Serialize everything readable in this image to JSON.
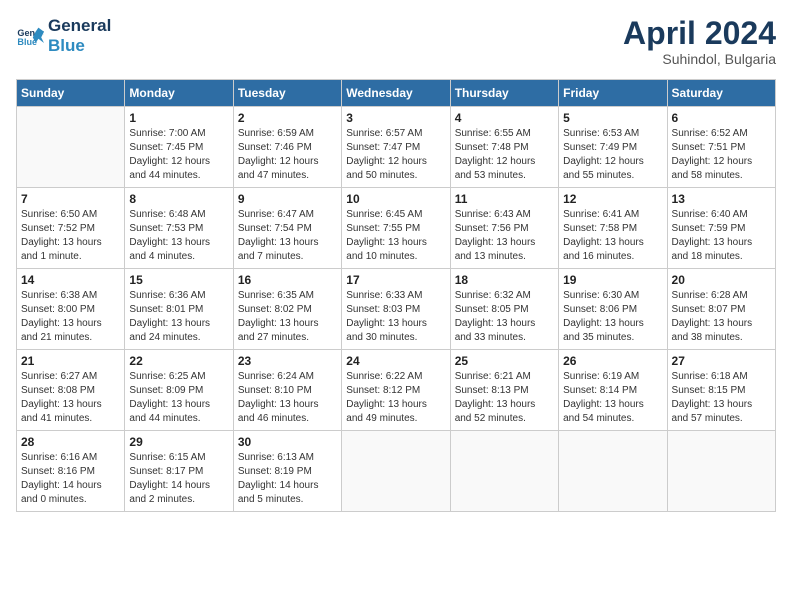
{
  "header": {
    "logo_general": "General",
    "logo_blue": "Blue",
    "month_title": "April 2024",
    "subtitle": "Suhindol, Bulgaria"
  },
  "days_of_week": [
    "Sunday",
    "Monday",
    "Tuesday",
    "Wednesday",
    "Thursday",
    "Friday",
    "Saturday"
  ],
  "weeks": [
    [
      {
        "day": "",
        "info": ""
      },
      {
        "day": "1",
        "info": "Sunrise: 7:00 AM\nSunset: 7:45 PM\nDaylight: 12 hours\nand 44 minutes."
      },
      {
        "day": "2",
        "info": "Sunrise: 6:59 AM\nSunset: 7:46 PM\nDaylight: 12 hours\nand 47 minutes."
      },
      {
        "day": "3",
        "info": "Sunrise: 6:57 AM\nSunset: 7:47 PM\nDaylight: 12 hours\nand 50 minutes."
      },
      {
        "day": "4",
        "info": "Sunrise: 6:55 AM\nSunset: 7:48 PM\nDaylight: 12 hours\nand 53 minutes."
      },
      {
        "day": "5",
        "info": "Sunrise: 6:53 AM\nSunset: 7:49 PM\nDaylight: 12 hours\nand 55 minutes."
      },
      {
        "day": "6",
        "info": "Sunrise: 6:52 AM\nSunset: 7:51 PM\nDaylight: 12 hours\nand 58 minutes."
      }
    ],
    [
      {
        "day": "7",
        "info": "Sunrise: 6:50 AM\nSunset: 7:52 PM\nDaylight: 13 hours\nand 1 minute."
      },
      {
        "day": "8",
        "info": "Sunrise: 6:48 AM\nSunset: 7:53 PM\nDaylight: 13 hours\nand 4 minutes."
      },
      {
        "day": "9",
        "info": "Sunrise: 6:47 AM\nSunset: 7:54 PM\nDaylight: 13 hours\nand 7 minutes."
      },
      {
        "day": "10",
        "info": "Sunrise: 6:45 AM\nSunset: 7:55 PM\nDaylight: 13 hours\nand 10 minutes."
      },
      {
        "day": "11",
        "info": "Sunrise: 6:43 AM\nSunset: 7:56 PM\nDaylight: 13 hours\nand 13 minutes."
      },
      {
        "day": "12",
        "info": "Sunrise: 6:41 AM\nSunset: 7:58 PM\nDaylight: 13 hours\nand 16 minutes."
      },
      {
        "day": "13",
        "info": "Sunrise: 6:40 AM\nSunset: 7:59 PM\nDaylight: 13 hours\nand 18 minutes."
      }
    ],
    [
      {
        "day": "14",
        "info": "Sunrise: 6:38 AM\nSunset: 8:00 PM\nDaylight: 13 hours\nand 21 minutes."
      },
      {
        "day": "15",
        "info": "Sunrise: 6:36 AM\nSunset: 8:01 PM\nDaylight: 13 hours\nand 24 minutes."
      },
      {
        "day": "16",
        "info": "Sunrise: 6:35 AM\nSunset: 8:02 PM\nDaylight: 13 hours\nand 27 minutes."
      },
      {
        "day": "17",
        "info": "Sunrise: 6:33 AM\nSunset: 8:03 PM\nDaylight: 13 hours\nand 30 minutes."
      },
      {
        "day": "18",
        "info": "Sunrise: 6:32 AM\nSunset: 8:05 PM\nDaylight: 13 hours\nand 33 minutes."
      },
      {
        "day": "19",
        "info": "Sunrise: 6:30 AM\nSunset: 8:06 PM\nDaylight: 13 hours\nand 35 minutes."
      },
      {
        "day": "20",
        "info": "Sunrise: 6:28 AM\nSunset: 8:07 PM\nDaylight: 13 hours\nand 38 minutes."
      }
    ],
    [
      {
        "day": "21",
        "info": "Sunrise: 6:27 AM\nSunset: 8:08 PM\nDaylight: 13 hours\nand 41 minutes."
      },
      {
        "day": "22",
        "info": "Sunrise: 6:25 AM\nSunset: 8:09 PM\nDaylight: 13 hours\nand 44 minutes."
      },
      {
        "day": "23",
        "info": "Sunrise: 6:24 AM\nSunset: 8:10 PM\nDaylight: 13 hours\nand 46 minutes."
      },
      {
        "day": "24",
        "info": "Sunrise: 6:22 AM\nSunset: 8:12 PM\nDaylight: 13 hours\nand 49 minutes."
      },
      {
        "day": "25",
        "info": "Sunrise: 6:21 AM\nSunset: 8:13 PM\nDaylight: 13 hours\nand 52 minutes."
      },
      {
        "day": "26",
        "info": "Sunrise: 6:19 AM\nSunset: 8:14 PM\nDaylight: 13 hours\nand 54 minutes."
      },
      {
        "day": "27",
        "info": "Sunrise: 6:18 AM\nSunset: 8:15 PM\nDaylight: 13 hours\nand 57 minutes."
      }
    ],
    [
      {
        "day": "28",
        "info": "Sunrise: 6:16 AM\nSunset: 8:16 PM\nDaylight: 14 hours\nand 0 minutes."
      },
      {
        "day": "29",
        "info": "Sunrise: 6:15 AM\nSunset: 8:17 PM\nDaylight: 14 hours\nand 2 minutes."
      },
      {
        "day": "30",
        "info": "Sunrise: 6:13 AM\nSunset: 8:19 PM\nDaylight: 14 hours\nand 5 minutes."
      },
      {
        "day": "",
        "info": ""
      },
      {
        "day": "",
        "info": ""
      },
      {
        "day": "",
        "info": ""
      },
      {
        "day": "",
        "info": ""
      }
    ]
  ]
}
